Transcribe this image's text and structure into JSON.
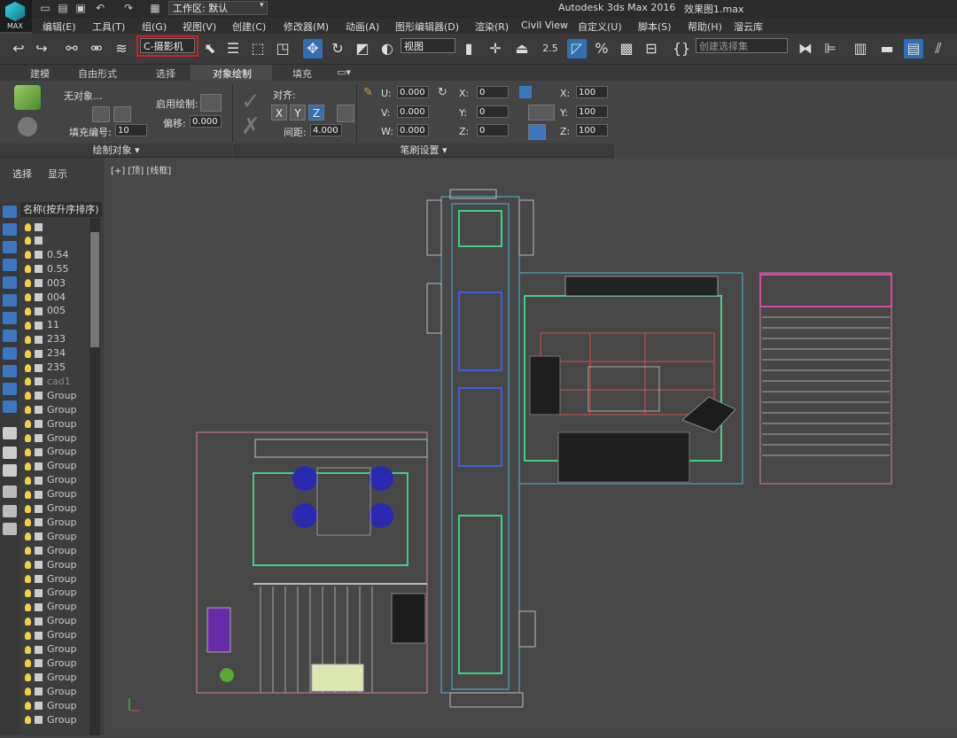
{
  "app": {
    "logo_label": "MAX",
    "workspace_value": "工作区: 默认",
    "title": "Autodesk 3ds Max 2016",
    "file": "效果图1.max"
  },
  "menus": [
    "编辑(E)",
    "工具(T)",
    "组(G)",
    "视图(V)",
    "创建(C)",
    "修改器(M)",
    "动画(A)",
    "图形编辑器(D)",
    "渲染(R)",
    "Civil View",
    "自定义(U)",
    "脚本(S)",
    "帮助(H)",
    "溜云库"
  ],
  "toolbar": {
    "camera_select": "C-摄影机",
    "view_select": "视图",
    "snap_value": "2.5",
    "selection_set_placeholder": "创建选择集"
  },
  "ribbon_tabs": [
    "建模",
    "自由形式",
    "选择",
    "对象绘制",
    "填充"
  ],
  "ribbon": {
    "no_object": "无对象...",
    "enable_paint": "启用绘制:",
    "offset_label": "偏移:",
    "offset_value": "0.000",
    "fill_number_label": "填充编号:",
    "fill_number_value": "10",
    "align_label": "对齐:",
    "axes": [
      "X",
      "Y",
      "Z"
    ],
    "spacing_label": "间距:",
    "spacing_value": "4.000",
    "u_label": "U:",
    "u_value": "0.000",
    "v_label": "V:",
    "v_value": "0.000",
    "w_label": "W:",
    "w_value": "0.000",
    "rx_label": "X:",
    "rx_value": "0",
    "ry_label": "Y:",
    "ry_value": "0",
    "rz_label": "Z:",
    "rz_value": "0",
    "sx_label": "X:",
    "sx_value": "100",
    "sy_label": "Y:",
    "sy_value": "100",
    "sz_label": "Z:",
    "sz_value": "100",
    "group_paint_objects": "绘制对象 ▾",
    "group_brush_settings": "笔刷设置 ▾"
  },
  "scene_explorer": {
    "tabs": [
      "选择",
      "显示"
    ],
    "column_header": "名称(按升序排序)",
    "items": [
      "",
      "",
      "0.54",
      "0.55",
      "003",
      "004",
      "005",
      "11",
      "233",
      "234",
      "235",
      "cad1",
      "Group",
      "Group",
      "Group",
      "Group",
      "Group",
      "Group",
      "Group",
      "Group",
      "Group",
      "Group",
      "Group",
      "Group",
      "Group",
      "Group",
      "Group",
      "Group",
      "Group",
      "Group",
      "Group",
      "Group",
      "Group",
      "Group",
      "Group",
      "Group",
      "Grou"
    ]
  },
  "viewport": {
    "label": "[+] [顶] [线框]"
  },
  "colors": {
    "accent": "#2e6fb5",
    "highlight_border": "#d02020",
    "viewport_bg": "#474747"
  }
}
